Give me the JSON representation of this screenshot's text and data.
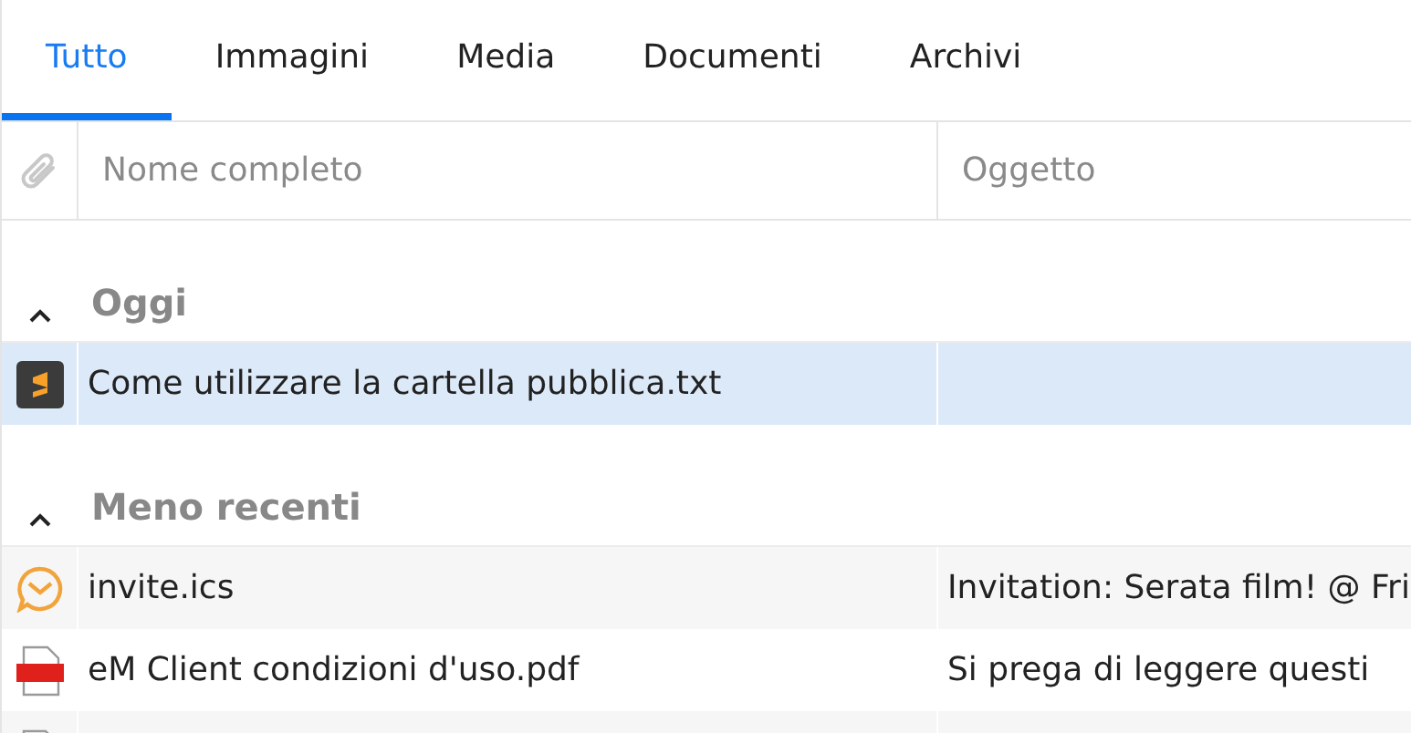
{
  "tabs": [
    {
      "label": "Tutto",
      "selected": true
    },
    {
      "label": "Immagini",
      "selected": false
    },
    {
      "label": "Media",
      "selected": false
    },
    {
      "label": "Documenti",
      "selected": false
    },
    {
      "label": "Archivi",
      "selected": false
    }
  ],
  "table": {
    "columns": [
      "Nome completo",
      "Oggetto"
    ],
    "groups": [
      {
        "title": "Oggi",
        "expanded": true,
        "rows": [
          {
            "kind": "sublime",
            "name": "Come utilizzare la cartella pubblica.txt",
            "selected": true
          }
        ]
      },
      {
        "title": "Meno recenti",
        "expanded": true,
        "rows": [
          {
            "kind": "emclient",
            "name": "invite.ics",
            "subject": "Invitation: Serata film! @ Fri",
            "selected": false
          },
          {
            "kind": "pdf",
            "name": "eM Client condizioni d'uso.pdf",
            "subject": "Si prega di leggere questi",
            "selected": false
          },
          {
            "kind": "file",
            "selected": false
          }
        ]
      }
    ]
  }
}
